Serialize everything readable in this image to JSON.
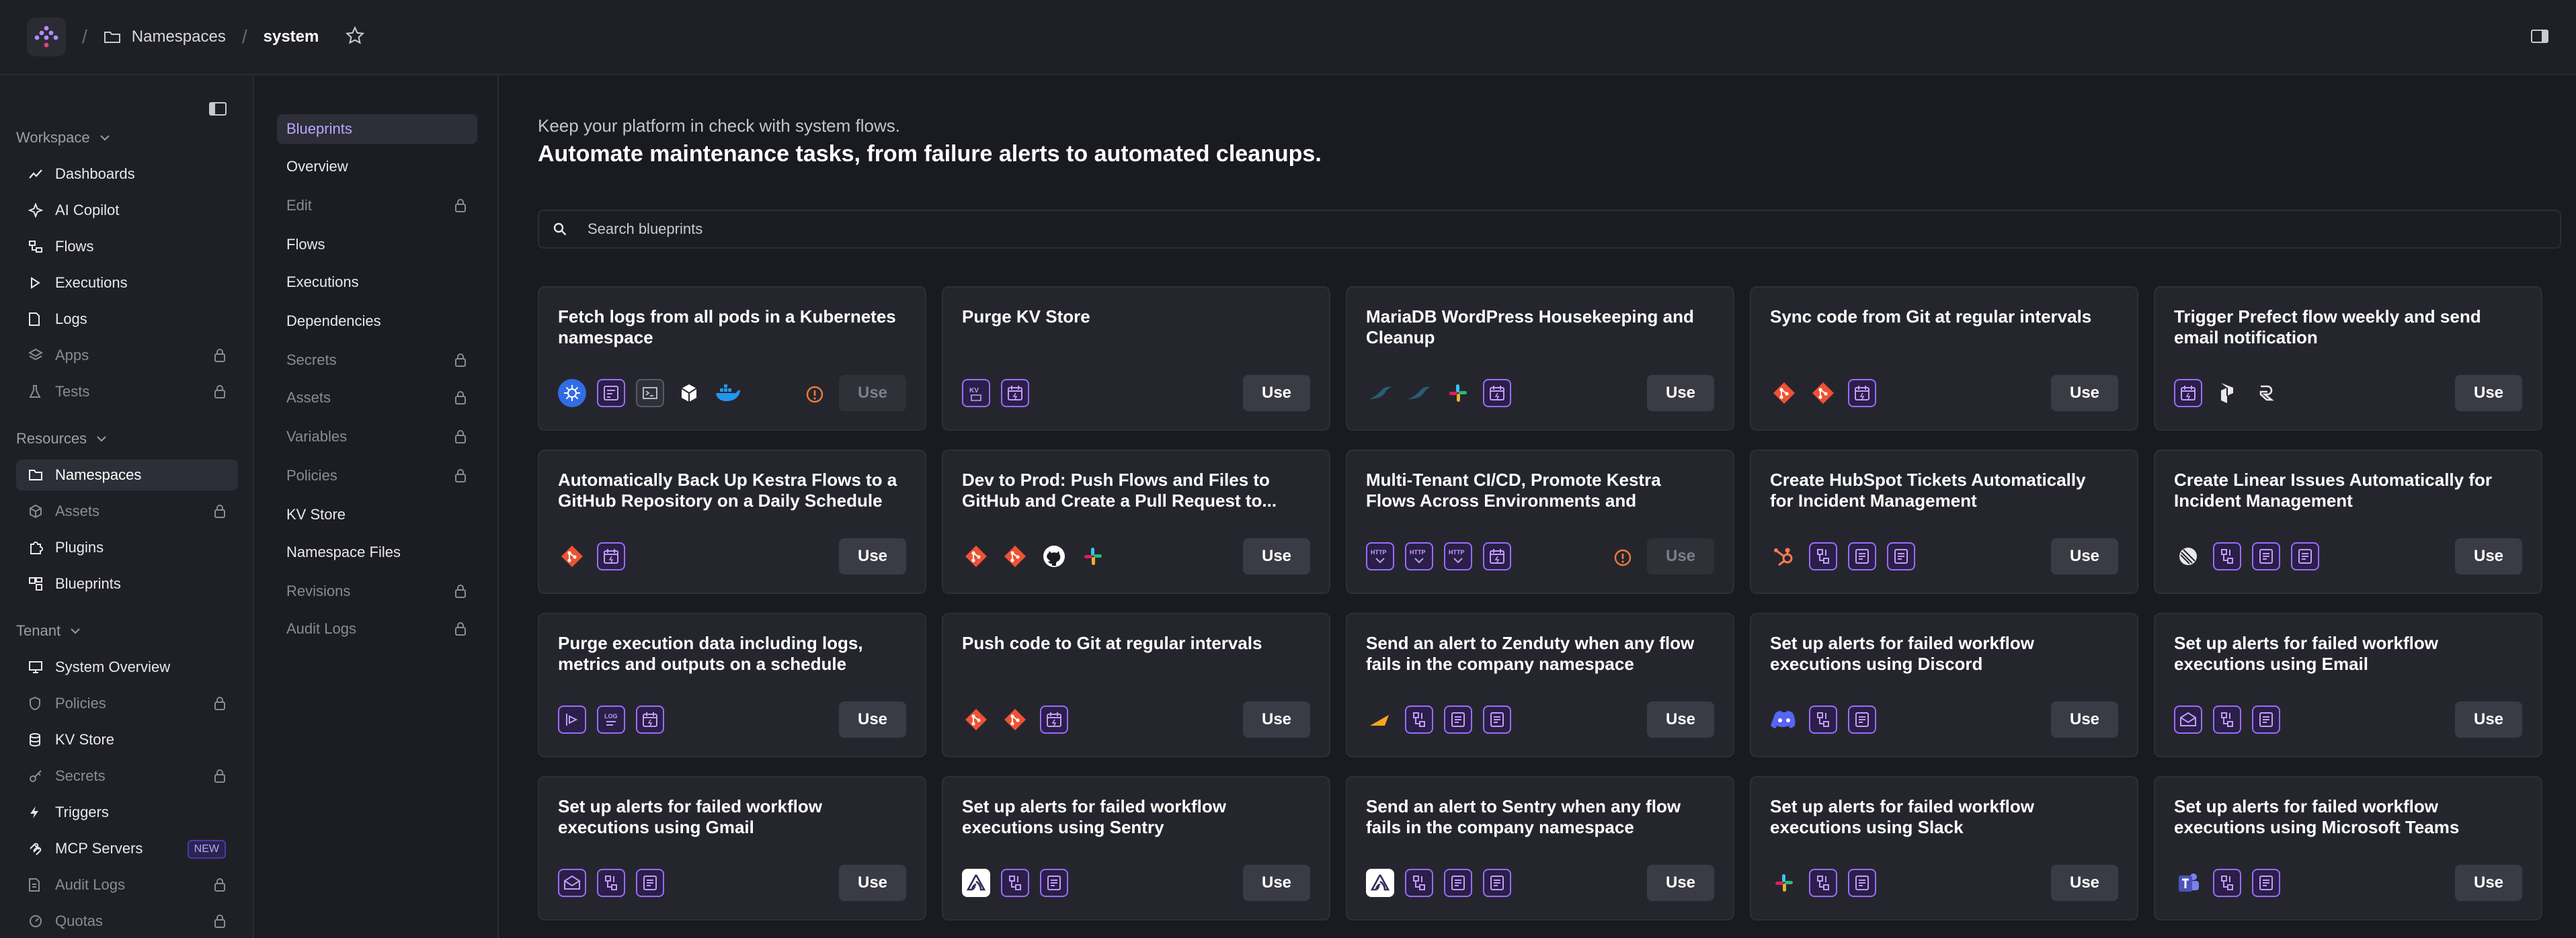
{
  "breadcrumb": {
    "namespaces": "Namespaces",
    "current": "system"
  },
  "sidebar": {
    "sections": [
      {
        "label": "Workspace",
        "items": [
          {
            "label": "Dashboards",
            "icon": "chart-line-icon",
            "locked": false
          },
          {
            "label": "AI Copilot",
            "icon": "sparkle-icon",
            "locked": false
          },
          {
            "label": "Flows",
            "icon": "flows-icon",
            "locked": false
          },
          {
            "label": "Executions",
            "icon": "play-icon",
            "locked": false
          },
          {
            "label": "Logs",
            "icon": "document-icon",
            "locked": false
          },
          {
            "label": "Apps",
            "icon": "layers-icon",
            "locked": true
          },
          {
            "label": "Tests",
            "icon": "flask-icon",
            "locked": true
          }
        ]
      },
      {
        "label": "Resources",
        "items": [
          {
            "label": "Namespaces",
            "icon": "folder-icon",
            "locked": false,
            "active": true
          },
          {
            "label": "Assets",
            "icon": "cube-icon",
            "locked": true
          },
          {
            "label": "Plugins",
            "icon": "puzzle-icon",
            "locked": false
          },
          {
            "label": "Blueprints",
            "icon": "blueprint-icon",
            "locked": false
          }
        ]
      },
      {
        "label": "Tenant",
        "items": [
          {
            "label": "System Overview",
            "icon": "monitor-icon",
            "locked": false
          },
          {
            "label": "Policies",
            "icon": "shield-icon",
            "locked": true
          },
          {
            "label": "KV Store",
            "icon": "database-icon",
            "locked": false
          },
          {
            "label": "Secrets",
            "icon": "key-icon",
            "locked": true
          },
          {
            "label": "Triggers",
            "icon": "bolt-icon",
            "locked": false
          },
          {
            "label": "MCP Servers",
            "icon": "mcp-icon",
            "locked": false,
            "badge": "NEW"
          },
          {
            "label": "Audit Logs",
            "icon": "audit-icon",
            "locked": true
          },
          {
            "label": "Quotas",
            "icon": "gauge-icon",
            "locked": true
          }
        ]
      }
    ]
  },
  "subnav": [
    {
      "label": "Blueprints",
      "active": true,
      "locked": false
    },
    {
      "label": "Overview",
      "locked": false
    },
    {
      "label": "Edit",
      "locked": true
    },
    {
      "label": "Flows",
      "locked": false
    },
    {
      "label": "Executions",
      "locked": false
    },
    {
      "label": "Dependencies",
      "locked": false
    },
    {
      "label": "Secrets",
      "locked": true
    },
    {
      "label": "Assets",
      "locked": true
    },
    {
      "label": "Variables",
      "locked": true
    },
    {
      "label": "Policies",
      "locked": true
    },
    {
      "label": "KV Store",
      "locked": false
    },
    {
      "label": "Namespace Files",
      "locked": false
    },
    {
      "label": "Revisions",
      "locked": true
    },
    {
      "label": "Audit Logs",
      "locked": true
    }
  ],
  "main": {
    "subtitle": "Keep your platform in check with system flows.",
    "title": "Automate maintenance tasks, from failure alerts to automated cleanups.",
    "search_placeholder": "Search blueprints"
  },
  "use_label": "Use",
  "cards": [
    {
      "title": "Fetch logs from all pods in a Kubernetes namespace",
      "icons": [
        "kubernetes-icon",
        "kestra-task-icon",
        "terminal-icon",
        "cube-icon",
        "docker-icon"
      ],
      "disabled": true
    },
    {
      "title": "Purge KV Store",
      "icons": [
        "kv-icon",
        "schedule-icon"
      ],
      "disabled": false
    },
    {
      "title": "MariaDB WordPress Housekeeping and Cleanup",
      "icons": [
        "mariadb-icon",
        "mariadb-icon",
        "slack-icon",
        "schedule-icon"
      ],
      "disabled": false
    },
    {
      "title": "Sync code from Git at regular intervals",
      "icons": [
        "git-icon",
        "git-icon",
        "schedule-icon"
      ],
      "disabled": false
    },
    {
      "title": "Trigger Prefect flow weekly and send email notification",
      "icons": [
        "schedule-icon",
        "prefect-icon",
        "resend-icon"
      ],
      "disabled": false
    },
    {
      "title": "Automatically Back Up Kestra Flows to a GitHub Repository on a Daily Schedule",
      "icons": [
        "git-icon",
        "schedule-icon"
      ],
      "disabled": false
    },
    {
      "title": "Dev to Prod: Push Flows and Files to GitHub and Create a Pull Request to...",
      "icons": [
        "git-icon",
        "git-icon",
        "github-icon",
        "slack-icon"
      ],
      "disabled": false
    },
    {
      "title": "Multi-Tenant CI/CD, Promote Kestra Flows Across Environments and Tenants...",
      "icons": [
        "http-icon",
        "http-icon",
        "http-icon",
        "schedule-icon"
      ],
      "disabled": true
    },
    {
      "title": "Create HubSpot Tickets Automatically for Incident Management",
      "icons": [
        "hubspot-icon",
        "flow-trigger-icon",
        "list-icon",
        "list-icon"
      ],
      "disabled": false
    },
    {
      "title": "Create Linear Issues Automatically for Incident Management",
      "icons": [
        "linear-icon",
        "flow-trigger-icon",
        "list-icon",
        "list-icon"
      ],
      "disabled": false
    },
    {
      "title": "Purge execution data including logs, metrics and outputs on a schedule",
      "icons": [
        "purge-icon",
        "purge-logs-icon",
        "schedule-icon"
      ],
      "disabled": false
    },
    {
      "title": "Push code to Git at regular intervals",
      "icons": [
        "git-icon",
        "git-icon",
        "schedule-icon"
      ],
      "disabled": false
    },
    {
      "title": "Send an alert to Zenduty when any flow fails in the company namespace",
      "icons": [
        "zenduty-icon",
        "flow-trigger-icon",
        "list-icon",
        "list-icon"
      ],
      "disabled": false
    },
    {
      "title": "Set up alerts for failed workflow executions using Discord",
      "icons": [
        "discord-icon",
        "flow-trigger-icon",
        "list-icon"
      ],
      "disabled": false
    },
    {
      "title": "Set up alerts for failed workflow executions using Email",
      "icons": [
        "email-icon",
        "flow-trigger-icon",
        "list-icon"
      ],
      "disabled": false
    },
    {
      "title": "Set up alerts for failed workflow executions using Gmail",
      "icons": [
        "email-icon",
        "flow-trigger-icon",
        "list-icon"
      ],
      "disabled": false
    },
    {
      "title": "Set up alerts for failed workflow executions using Sentry",
      "icons": [
        "sentry-icon",
        "flow-trigger-icon",
        "list-icon"
      ],
      "disabled": false
    },
    {
      "title": "Send an alert to Sentry when any flow fails in the company namespace",
      "icons": [
        "sentry-icon",
        "flow-trigger-icon",
        "list-icon",
        "list-icon"
      ],
      "disabled": false
    },
    {
      "title": "Set up alerts for failed workflow executions using Slack",
      "icons": [
        "slack-icon",
        "flow-trigger-icon",
        "list-icon"
      ],
      "disabled": false
    },
    {
      "title": "Set up alerts for failed workflow executions using Microsoft Teams",
      "icons": [
        "teams-icon",
        "flow-trigger-icon",
        "list-icon"
      ],
      "disabled": false
    }
  ],
  "colors": {
    "accent": "#9b6cff",
    "background": "#1a1b20",
    "card": "#25262d",
    "warning": "#f07a3a"
  }
}
